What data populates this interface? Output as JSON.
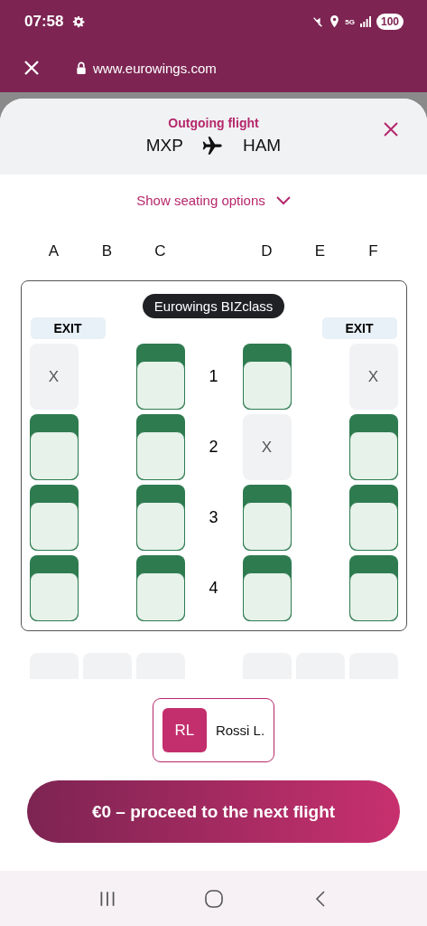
{
  "status_bar": {
    "time": "07:58",
    "network": "5G",
    "battery": "100"
  },
  "browser": {
    "url": "www.eurowings.com"
  },
  "header": {
    "title": "Outgoing flight",
    "origin": "MXP",
    "destination": "HAM"
  },
  "seating_toggle": {
    "label": "Show seating options",
    "expanded": false
  },
  "columns": [
    "A",
    "B",
    "C",
    "",
    "D",
    "E",
    "F"
  ],
  "cabin": {
    "badge": "Eurowings BIZclass",
    "exits": [
      "EXIT",
      "EXIT"
    ],
    "rows": [
      {
        "number": "1",
        "seats": [
          {
            "kind": "unavailable",
            "label": "X"
          },
          {
            "kind": "none"
          },
          {
            "kind": "available"
          },
          {
            "kind": "available"
          },
          {
            "kind": "none"
          },
          {
            "kind": "unavailable",
            "label": "X"
          }
        ]
      },
      {
        "number": "2",
        "seats": [
          {
            "kind": "available"
          },
          {
            "kind": "none"
          },
          {
            "kind": "available"
          },
          {
            "kind": "unavailable",
            "label": "X"
          },
          {
            "kind": "none"
          },
          {
            "kind": "available"
          }
        ]
      },
      {
        "number": "3",
        "seats": [
          {
            "kind": "available"
          },
          {
            "kind": "none"
          },
          {
            "kind": "available"
          },
          {
            "kind": "available"
          },
          {
            "kind": "none"
          },
          {
            "kind": "available"
          }
        ]
      },
      {
        "number": "4",
        "seats": [
          {
            "kind": "available"
          },
          {
            "kind": "none"
          },
          {
            "kind": "available"
          },
          {
            "kind": "available"
          },
          {
            "kind": "none"
          },
          {
            "kind": "available"
          }
        ]
      }
    ]
  },
  "next_row_preview": {
    "seats": [
      {
        "kind": "unavailable"
      },
      {
        "kind": "unavailable"
      },
      {
        "kind": "unavailable"
      },
      {
        "kind": "unavailable"
      },
      {
        "kind": "unavailable"
      },
      {
        "kind": "unavailable"
      }
    ]
  },
  "passengers": [
    {
      "initials": "RL",
      "name": "Rossi L.",
      "selected": true
    }
  ],
  "proceed_button": {
    "label": "€0 – proceed to the next flight"
  }
}
